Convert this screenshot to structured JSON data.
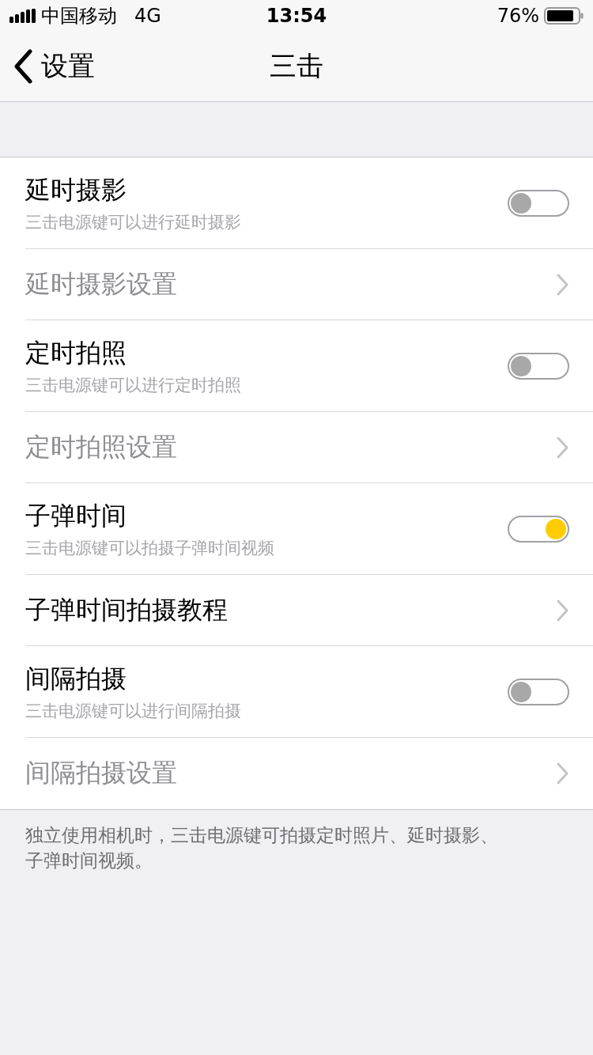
{
  "status_bar": {
    "carrier": "中国移动",
    "network": "4G",
    "time": "13:54",
    "battery": "76%"
  },
  "nav": {
    "back": "设置",
    "title": "三击"
  },
  "rows": [
    {
      "kind": "toggle",
      "title": "延时摄影",
      "subtitle": "三击电源键可以进行延时摄影",
      "on": false
    },
    {
      "kind": "link",
      "title": "延时摄影设置",
      "disabled": true
    },
    {
      "kind": "toggle",
      "title": "定时拍照",
      "subtitle": "三击电源键可以进行定时拍照",
      "on": false
    },
    {
      "kind": "link",
      "title": "定时拍照设置",
      "disabled": true
    },
    {
      "kind": "toggle",
      "title": "子弹时间",
      "subtitle": "三击电源键可以拍摄子弹时间视频",
      "on": true
    },
    {
      "kind": "link",
      "title": "子弹时间拍摄教程",
      "disabled": false
    },
    {
      "kind": "toggle",
      "title": "间隔拍摄",
      "subtitle": "三击电源键可以进行间隔拍摄",
      "on": false
    },
    {
      "kind": "link",
      "title": "间隔拍摄设置",
      "disabled": true
    }
  ],
  "footer": "独立使用相机时，三击电源键可拍摄定时照片、延时摄影、子弹时间视频。"
}
